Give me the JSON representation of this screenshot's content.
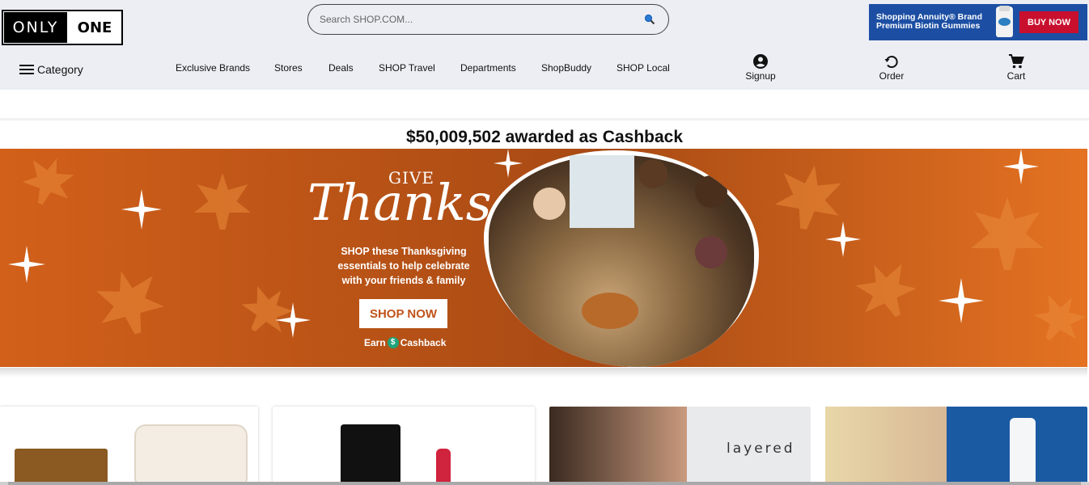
{
  "header": {
    "logo": {
      "part1": "ONLY",
      "part2": "ONE"
    },
    "search": {
      "placeholder": "Search SHOP.COM..."
    },
    "ad": {
      "line1": "Shopping Annuity® Brand",
      "line2": "Premium Biotin Gummies",
      "button": "BUY NOW"
    }
  },
  "nav": {
    "category": "Category",
    "links": [
      "Exclusive Brands",
      "Stores",
      "Deals",
      "SHOP Travel",
      "Departments",
      "ShopBuddy",
      "SHOP Local"
    ],
    "actions": [
      {
        "label": "Signup",
        "icon": "account-circle-icon"
      },
      {
        "label": "Order",
        "icon": "history-icon"
      },
      {
        "label": "Cart",
        "icon": "cart-icon"
      }
    ]
  },
  "cashback": {
    "text": "$50,009,502 awarded as Cashback"
  },
  "banner": {
    "give": "GIVE",
    "thanks": "Thanks",
    "blurb": "SHOP these Thanksgiving essentials to help celebrate with your friends & family",
    "cta": "SHOP NOW",
    "earn_prefix": "Earn",
    "earn_suffix": "Cashback",
    "coin_symbol": "$"
  },
  "cards": {
    "card3_text": "layered"
  },
  "colors": {
    "topbar": "#eceef4",
    "ad_blue": "#1c4fa3",
    "buy_red": "#c8102e",
    "banner_orange": "#d86519",
    "cashback_green": "#1fa37a"
  }
}
